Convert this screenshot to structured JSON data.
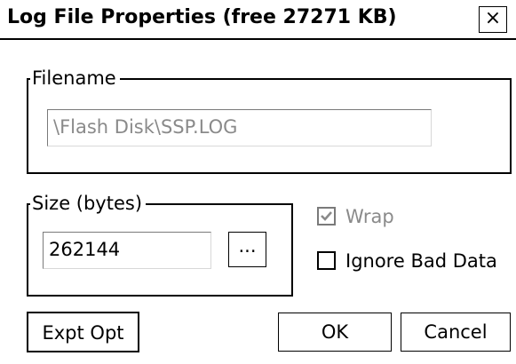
{
  "dialog": {
    "title": "Log File Properties (free 27271 KB)",
    "close_glyph": "×"
  },
  "filename_group": {
    "label": "Filename",
    "value": "\\Flash Disk\\SSP.LOG",
    "enabled": false
  },
  "size_group": {
    "label": "Size (bytes)",
    "value": "262144",
    "browse_label": "..."
  },
  "options": {
    "wrap": {
      "label": "Wrap",
      "checked": true,
      "enabled": false
    },
    "ignore_bad_data": {
      "label": "Ignore Bad Data",
      "checked": false,
      "enabled": true
    }
  },
  "buttons": {
    "expt_opt": "Expt Opt",
    "ok": "OK",
    "cancel": "Cancel"
  },
  "colors": {
    "disabled_text": "#8a8a8a",
    "border": "#000000"
  }
}
